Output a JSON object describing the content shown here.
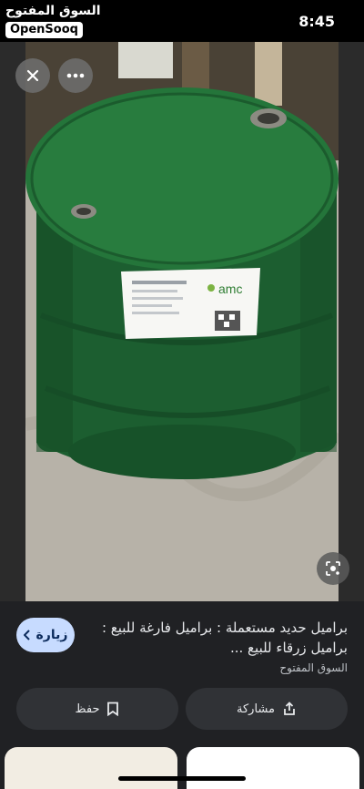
{
  "status_bar": {
    "brand_arabic": "السوق المفتوح",
    "brand_latin": "OpenSooq",
    "time": "8:45"
  },
  "viewer": {
    "drum_label_brand": "amc"
  },
  "result": {
    "title": "براميل حديد مستعملة : براميل فارغة للبيع : براميل زرقاء للبيع ...",
    "source": "السوق المفتوح",
    "visit_label": "زيارة",
    "save_label": "حفظ",
    "share_label": "مشاركة"
  },
  "colors": {
    "visit_bg": "#c7dbff",
    "panel_bg": "#202124",
    "button_bg": "#303236"
  }
}
